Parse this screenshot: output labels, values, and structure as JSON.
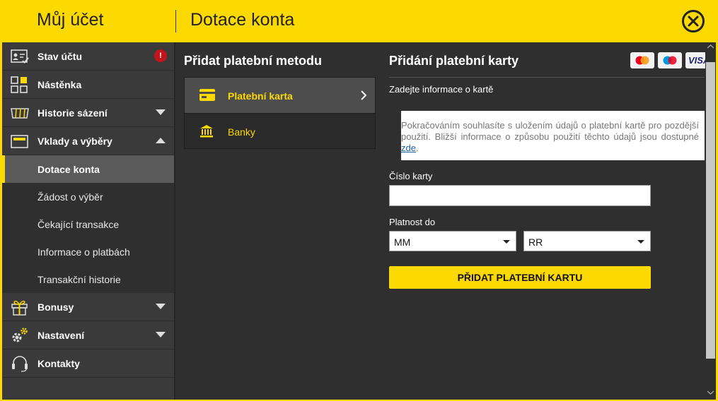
{
  "header": {
    "account_title": "Můj účet",
    "page_title": "Dotace konta",
    "close_icon": "close-circle-icon"
  },
  "sidebar": {
    "items": [
      {
        "label": "Stav účtu",
        "icon": "account-card-icon",
        "badge": "!"
      },
      {
        "label": "Nástěnka",
        "icon": "dashboard-grid-icon"
      },
      {
        "label": "Historie sázení",
        "icon": "tickets-icon",
        "expanded": false
      },
      {
        "label": "Vklady a výběry",
        "icon": "wallet-icon",
        "expanded": true
      },
      {
        "label": "Bonusy",
        "icon": "gift-icon",
        "expanded": false
      },
      {
        "label": "Nastavení",
        "icon": "gears-icon",
        "expanded": false
      },
      {
        "label": "Kontakty",
        "icon": "headset-icon"
      }
    ],
    "subitems": [
      {
        "label": "Dotace konta",
        "active": true
      },
      {
        "label": "Žádost o výběr"
      },
      {
        "label": "Čekající transakce"
      },
      {
        "label": "Informace o platbách"
      },
      {
        "label": "Transakční historie"
      }
    ]
  },
  "methods": {
    "title": "Přidat platební metodu",
    "items": [
      {
        "label": "Platební karta",
        "icon": "credit-card-icon",
        "active": true
      },
      {
        "label": "Banky",
        "icon": "bank-icon"
      }
    ]
  },
  "card_form": {
    "title": "Přidání platební karty",
    "subtitle": "Zadejte informace o kartě",
    "notice_text": "Pokračováním souhlasíte s uložením údajů o platební kartě pro pozdější použití. Bližší informace o způsobu použití těchto údajů jsou dostupné ",
    "notice_link": "zde",
    "notice_end": ".",
    "card_number_label": "Číslo karty",
    "card_number_value": "",
    "expiry_label": "Platnost do",
    "month_value": "MM",
    "year_value": "RR",
    "submit_label": "PŘIDAT PLATEBNÍ KARTU",
    "logos": [
      "mastercard-logo",
      "maestro-logo",
      "visa-logo"
    ],
    "visa_text": "VISA"
  },
  "colors": {
    "accent": "#fcd900",
    "background": "#2f2f2f",
    "sidebar": "#3a3a3a",
    "alert": "#c0151c"
  }
}
